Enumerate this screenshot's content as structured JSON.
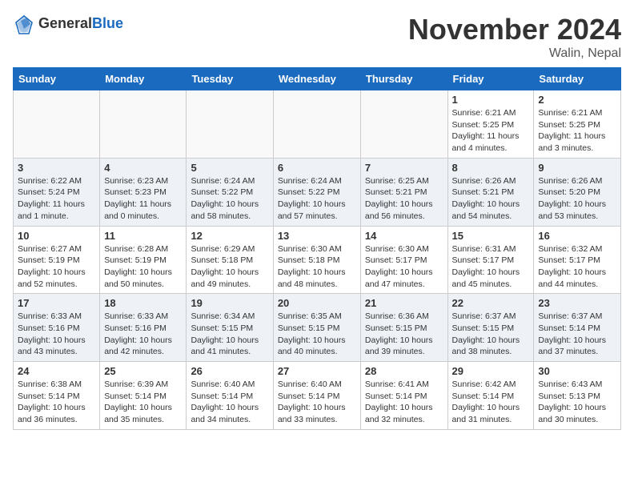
{
  "header": {
    "logo_general": "General",
    "logo_blue": "Blue",
    "month": "November 2024",
    "location": "Walin, Nepal"
  },
  "weekdays": [
    "Sunday",
    "Monday",
    "Tuesday",
    "Wednesday",
    "Thursday",
    "Friday",
    "Saturday"
  ],
  "weeks": [
    [
      {
        "day": "",
        "info": ""
      },
      {
        "day": "",
        "info": ""
      },
      {
        "day": "",
        "info": ""
      },
      {
        "day": "",
        "info": ""
      },
      {
        "day": "",
        "info": ""
      },
      {
        "day": "1",
        "info": "Sunrise: 6:21 AM\nSunset: 5:25 PM\nDaylight: 11 hours and 4 minutes."
      },
      {
        "day": "2",
        "info": "Sunrise: 6:21 AM\nSunset: 5:25 PM\nDaylight: 11 hours and 3 minutes."
      }
    ],
    [
      {
        "day": "3",
        "info": "Sunrise: 6:22 AM\nSunset: 5:24 PM\nDaylight: 11 hours and 1 minute."
      },
      {
        "day": "4",
        "info": "Sunrise: 6:23 AM\nSunset: 5:23 PM\nDaylight: 11 hours and 0 minutes."
      },
      {
        "day": "5",
        "info": "Sunrise: 6:24 AM\nSunset: 5:22 PM\nDaylight: 10 hours and 58 minutes."
      },
      {
        "day": "6",
        "info": "Sunrise: 6:24 AM\nSunset: 5:22 PM\nDaylight: 10 hours and 57 minutes."
      },
      {
        "day": "7",
        "info": "Sunrise: 6:25 AM\nSunset: 5:21 PM\nDaylight: 10 hours and 56 minutes."
      },
      {
        "day": "8",
        "info": "Sunrise: 6:26 AM\nSunset: 5:21 PM\nDaylight: 10 hours and 54 minutes."
      },
      {
        "day": "9",
        "info": "Sunrise: 6:26 AM\nSunset: 5:20 PM\nDaylight: 10 hours and 53 minutes."
      }
    ],
    [
      {
        "day": "10",
        "info": "Sunrise: 6:27 AM\nSunset: 5:19 PM\nDaylight: 10 hours and 52 minutes."
      },
      {
        "day": "11",
        "info": "Sunrise: 6:28 AM\nSunset: 5:19 PM\nDaylight: 10 hours and 50 minutes."
      },
      {
        "day": "12",
        "info": "Sunrise: 6:29 AM\nSunset: 5:18 PM\nDaylight: 10 hours and 49 minutes."
      },
      {
        "day": "13",
        "info": "Sunrise: 6:30 AM\nSunset: 5:18 PM\nDaylight: 10 hours and 48 minutes."
      },
      {
        "day": "14",
        "info": "Sunrise: 6:30 AM\nSunset: 5:17 PM\nDaylight: 10 hours and 47 minutes."
      },
      {
        "day": "15",
        "info": "Sunrise: 6:31 AM\nSunset: 5:17 PM\nDaylight: 10 hours and 45 minutes."
      },
      {
        "day": "16",
        "info": "Sunrise: 6:32 AM\nSunset: 5:17 PM\nDaylight: 10 hours and 44 minutes."
      }
    ],
    [
      {
        "day": "17",
        "info": "Sunrise: 6:33 AM\nSunset: 5:16 PM\nDaylight: 10 hours and 43 minutes."
      },
      {
        "day": "18",
        "info": "Sunrise: 6:33 AM\nSunset: 5:16 PM\nDaylight: 10 hours and 42 minutes."
      },
      {
        "day": "19",
        "info": "Sunrise: 6:34 AM\nSunset: 5:15 PM\nDaylight: 10 hours and 41 minutes."
      },
      {
        "day": "20",
        "info": "Sunrise: 6:35 AM\nSunset: 5:15 PM\nDaylight: 10 hours and 40 minutes."
      },
      {
        "day": "21",
        "info": "Sunrise: 6:36 AM\nSunset: 5:15 PM\nDaylight: 10 hours and 39 minutes."
      },
      {
        "day": "22",
        "info": "Sunrise: 6:37 AM\nSunset: 5:15 PM\nDaylight: 10 hours and 38 minutes."
      },
      {
        "day": "23",
        "info": "Sunrise: 6:37 AM\nSunset: 5:14 PM\nDaylight: 10 hours and 37 minutes."
      }
    ],
    [
      {
        "day": "24",
        "info": "Sunrise: 6:38 AM\nSunset: 5:14 PM\nDaylight: 10 hours and 36 minutes."
      },
      {
        "day": "25",
        "info": "Sunrise: 6:39 AM\nSunset: 5:14 PM\nDaylight: 10 hours and 35 minutes."
      },
      {
        "day": "26",
        "info": "Sunrise: 6:40 AM\nSunset: 5:14 PM\nDaylight: 10 hours and 34 minutes."
      },
      {
        "day": "27",
        "info": "Sunrise: 6:40 AM\nSunset: 5:14 PM\nDaylight: 10 hours and 33 minutes."
      },
      {
        "day": "28",
        "info": "Sunrise: 6:41 AM\nSunset: 5:14 PM\nDaylight: 10 hours and 32 minutes."
      },
      {
        "day": "29",
        "info": "Sunrise: 6:42 AM\nSunset: 5:14 PM\nDaylight: 10 hours and 31 minutes."
      },
      {
        "day": "30",
        "info": "Sunrise: 6:43 AM\nSunset: 5:13 PM\nDaylight: 10 hours and 30 minutes."
      }
    ]
  ]
}
